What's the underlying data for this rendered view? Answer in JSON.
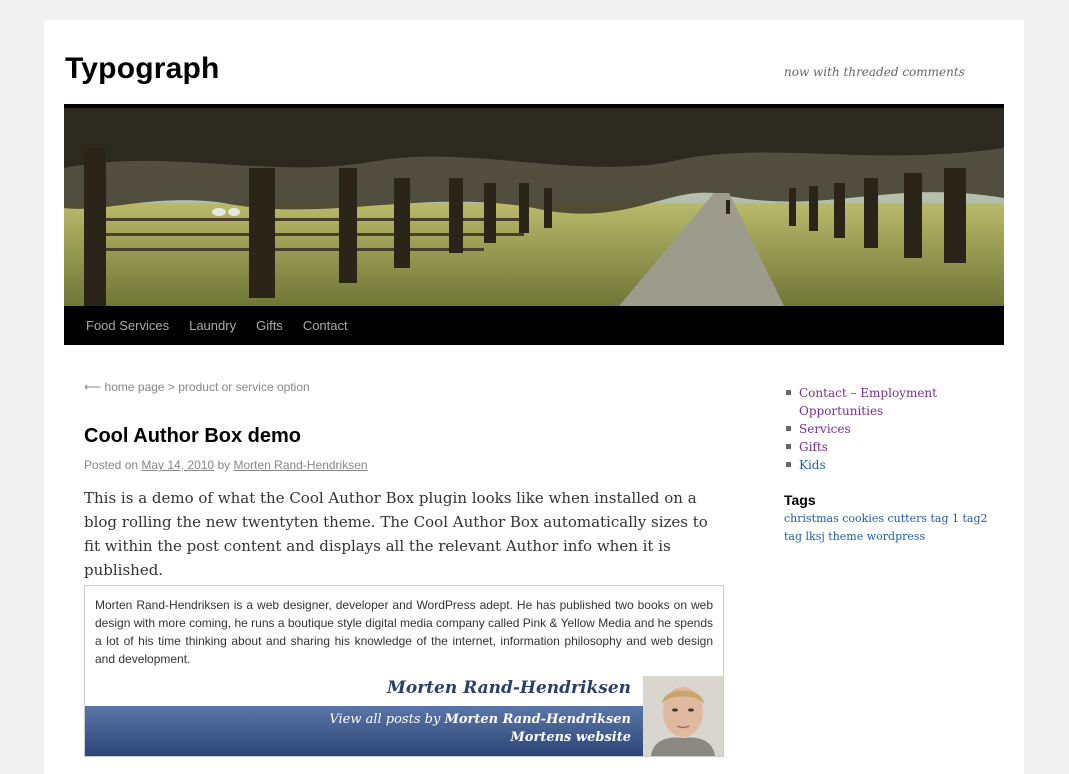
{
  "site": {
    "title": "Typograph",
    "description": "now with threaded comments"
  },
  "menu": [
    "Food Services",
    "Laundry",
    "Gifts",
    "Contact"
  ],
  "breadcrumb": "⟵ home page > product or service option",
  "post": {
    "title": "Cool Author Box demo",
    "meta_prefix": "Posted on",
    "date": "May 14, 2010",
    "meta_by": "by",
    "author": "Morten Rand-Hendriksen",
    "body": "This is a demo of what the Cool Author Box plugin looks like when installed on a blog rolling the new twentyten theme. The Cool Author Box automatically sizes to fit within the post content and displays all the relevant Author info when it is published."
  },
  "author_box": {
    "bio": "Morten Rand-Hendriksen is a web designer, developer and WordPress adept. He has published two books on web design with more coming, he runs a boutique style digital media company called Pink & Yellow Media and he spends a lot of his time thinking about and sharing his knowledge of the internet, information philosophy and web design and development.",
    "name": "Morten Rand-Hendriksen",
    "view_posts_prefix": "View all posts by",
    "view_posts_name": "Morten Rand-Hendriksen",
    "website_label": "Mortens website"
  },
  "sidebar": {
    "pages": [
      "Contact – Employment Opportunities",
      "Services",
      "Gifts",
      "Kids"
    ],
    "tags_title": "Tags",
    "tags": [
      "christmas",
      "cookies",
      "cutters",
      "tag 1",
      "tag2",
      "tag",
      "lksj",
      "theme",
      "wordpress"
    ]
  },
  "colors": {
    "link_purple": "#7a2d91",
    "link_blue": "#1f5ea8",
    "author_bar": "#2c4576"
  }
}
